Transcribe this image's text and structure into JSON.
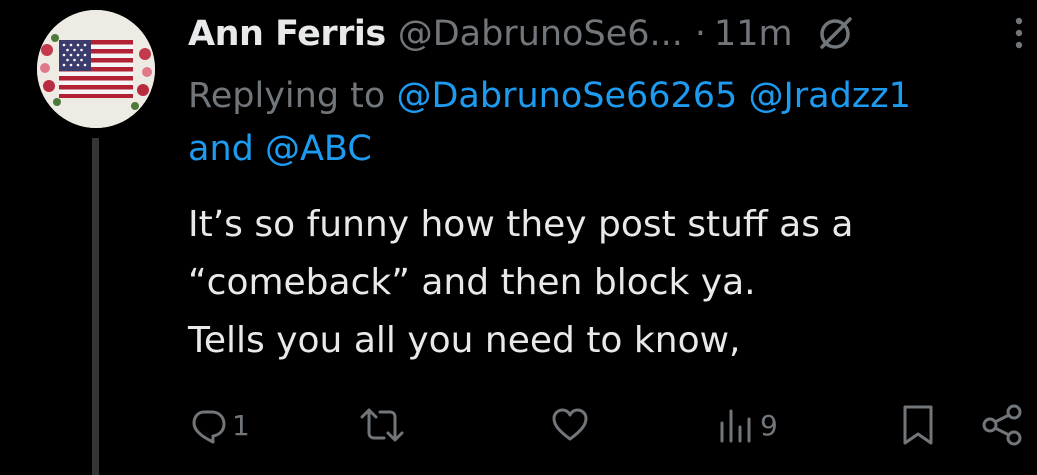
{
  "colors": {
    "background": "#000000",
    "primary_text": "#e7e9ea",
    "secondary_text": "#71767b",
    "link": "#1d9bf0",
    "thread_line": "#333639"
  },
  "author": {
    "display_name": "Ann Ferris",
    "handle": "@DabrunoSe6...",
    "separator": "·",
    "time": "11m",
    "avatar_icon": "american-flag-avatar",
    "muted_icon": "muted-icon"
  },
  "reply_context": {
    "prefix": "Replying to ",
    "mention_1": "@DabrunoSe66265",
    "mention_2": "@Jradzz1",
    "conjunction": "and ",
    "mention_3": "@ABC"
  },
  "tweet": {
    "lines": [
      "It’s so funny how they post stuff as a",
      "“comeback” and then block ya.",
      "Tells you all you need to know,"
    ]
  },
  "actions": {
    "reply_count": "1",
    "retweet_count": "",
    "like_count": "",
    "views_count": "9",
    "icons": [
      "reply-icon",
      "retweet-icon",
      "like-icon",
      "views-icon",
      "bookmark-icon",
      "share-icon"
    ]
  }
}
